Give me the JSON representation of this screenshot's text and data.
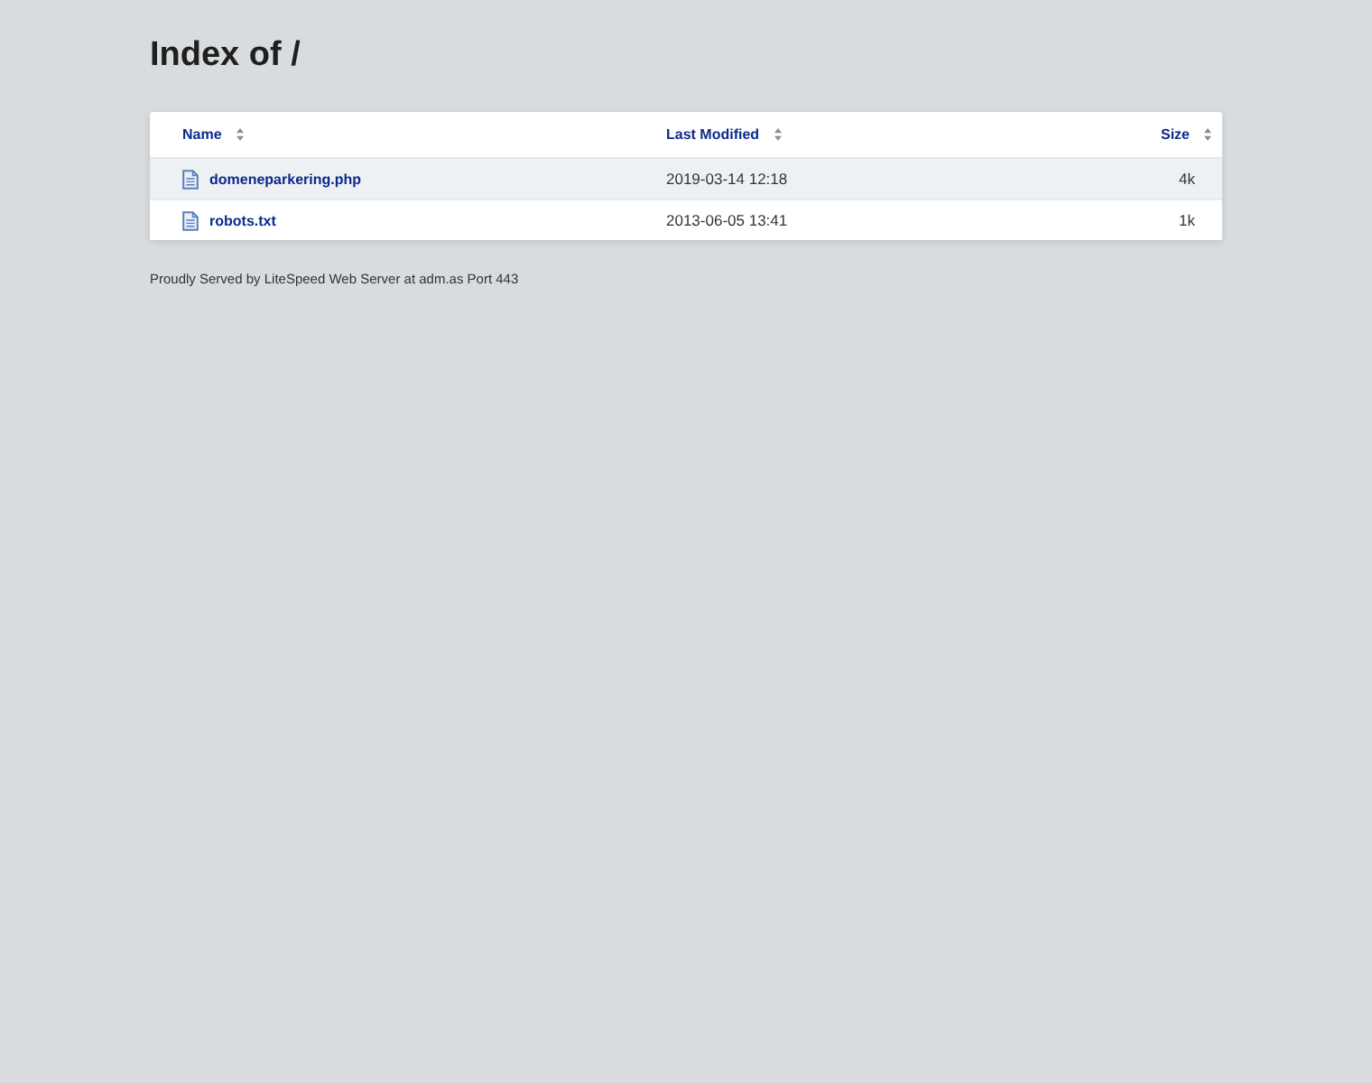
{
  "heading": "Index of /",
  "table": {
    "columns": [
      {
        "label": "Name"
      },
      {
        "label": "Last Modified"
      },
      {
        "label": "Size"
      }
    ],
    "rows": [
      {
        "name": "domeneparkering.php",
        "modified": "2019-03-14 12:18",
        "size": "4k",
        "selected": true
      },
      {
        "name": "robots.txt",
        "modified": "2013-06-05 13:41",
        "size": "1k",
        "selected": false
      }
    ]
  },
  "footer": "Proudly Served by LiteSpeed Web Server at adm.as Port 443"
}
